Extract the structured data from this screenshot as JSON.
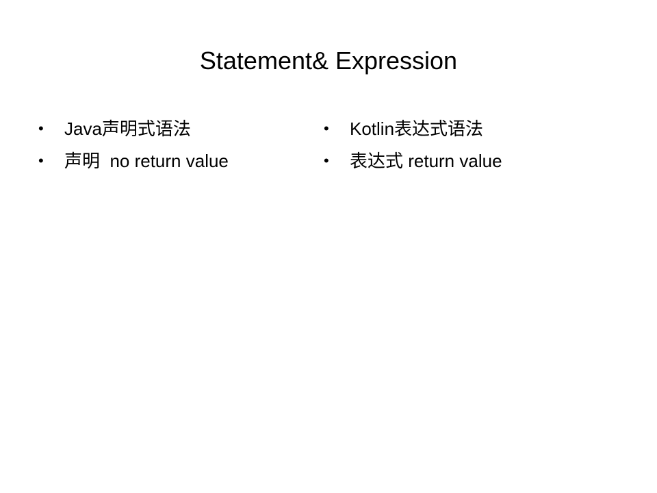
{
  "slide": {
    "title": "Statement& Expression",
    "left_column": [
      {
        "bullet": "•",
        "text": "Java声明式语法"
      },
      {
        "bullet": "•",
        "text": "声明  no return value"
      }
    ],
    "right_column": [
      {
        "bullet": "•",
        "text": "Kotlin表达式语法"
      },
      {
        "bullet": "•",
        "text": "表达式 return value"
      }
    ]
  }
}
